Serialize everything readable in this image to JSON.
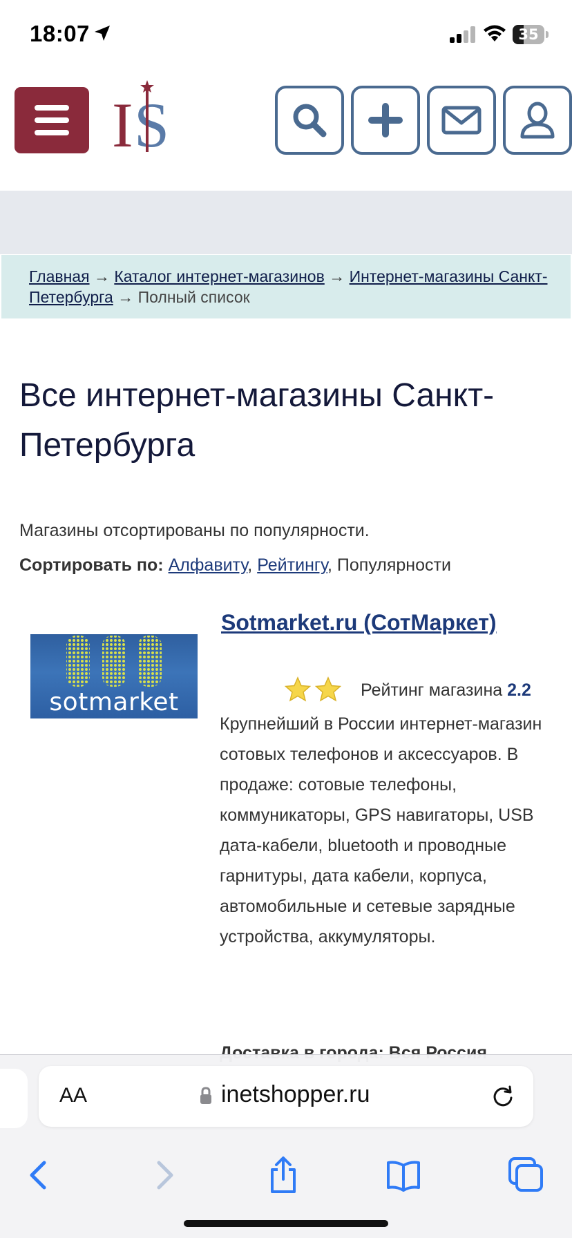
{
  "status_bar": {
    "time": "18:07",
    "battery": "35",
    "icons": [
      "location-arrow-icon",
      "cellular-signal-icon",
      "wifi-icon",
      "battery-icon"
    ]
  },
  "header": {
    "menu_icon": "hamburger-icon",
    "logo_text": "I$",
    "buttons": [
      "search-icon",
      "plus-icon",
      "mail-icon",
      "user-icon"
    ],
    "brand_color": "#8a2a3b",
    "button_border_color": "#4a6a90"
  },
  "breadcrumb": {
    "home": "Главная",
    "sep": "→",
    "catalog": "Каталог интернет-магазинов",
    "spb": "Интернет-магазины Санкт-Петербурга",
    "current": "Полный список"
  },
  "page": {
    "title": "Все интернет-магазины Санкт-Петербурга",
    "sorted_note": "Магазины отсортированы по популярности.",
    "sort_label": "Сортировать по:",
    "sort_alpha": "Алфавиту",
    "sort_rating": "Рейтингу",
    "sort_popularity": "Популярности"
  },
  "shop": {
    "logo_text": "sotmarket",
    "title": "Sotmarket.ru (СотМаркет)",
    "rating_label": "Рейтинг магазина",
    "rating_value": "2.2",
    "stars_shown": 2,
    "description": "Крупнейший в России интернет-магазин сотовых телефонов и аксессуаров. В продаже: сотовые телефоны, коммуникаторы, GPS навигаторы, USB дата-кабели, bluetooth и проводные гарнитуры, дата кабели, корпуса, автомобильные и сетевые зарядные устройства, аккумуляторы.",
    "delivery": "Доставка в города: Вся Россия"
  },
  "safari": {
    "aa_label": "AA",
    "url": "inetshopper.ru",
    "toolbar": [
      "back-icon",
      "forward-icon",
      "share-icon",
      "bookmarks-icon",
      "tabs-icon"
    ]
  }
}
